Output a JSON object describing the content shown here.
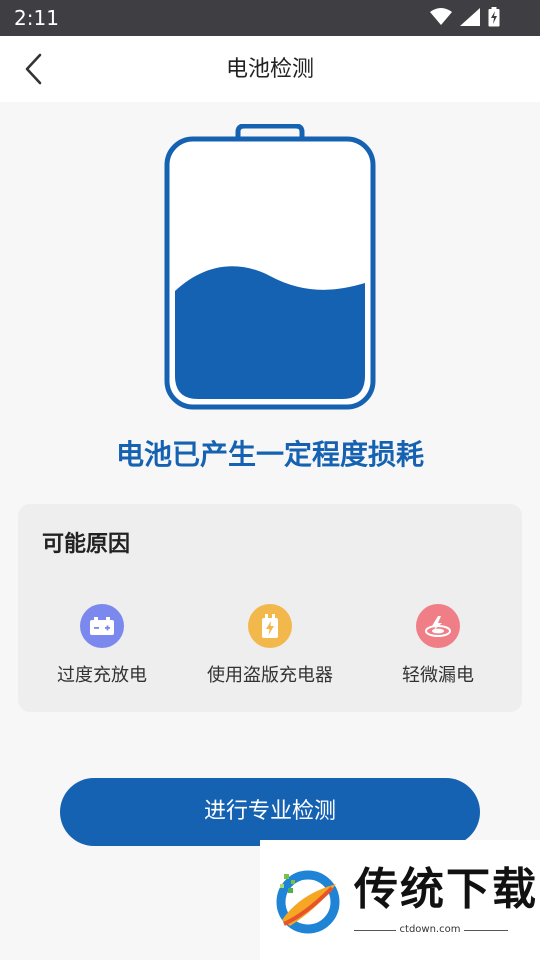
{
  "status_bar": {
    "time": "2:11",
    "icons": [
      "wifi-icon",
      "signal-icon",
      "battery-charging-icon"
    ]
  },
  "header": {
    "title": "电池检测",
    "back_icon": "chevron-left-icon"
  },
  "battery": {
    "level": 0.35,
    "color": "#1662b2"
  },
  "headline": "电池已产生一定程度损耗",
  "reasons": {
    "title": "可能原因",
    "items": [
      {
        "label": "过度充放电",
        "icon": "battery-icon",
        "color": "#7b88ee"
      },
      {
        "label": "使用盗版充电器",
        "icon": "charger-icon",
        "color": "#f2b84b"
      },
      {
        "label": "轻微漏电",
        "icon": "leak-icon",
        "color": "#ef7e86"
      }
    ]
  },
  "cta": {
    "label": "进行专业检测"
  },
  "watermark": {
    "brand": "传统下载",
    "domain": "ctdown.com"
  },
  "colors": {
    "primary": "#1662b2",
    "background": "#f7f7f7"
  }
}
